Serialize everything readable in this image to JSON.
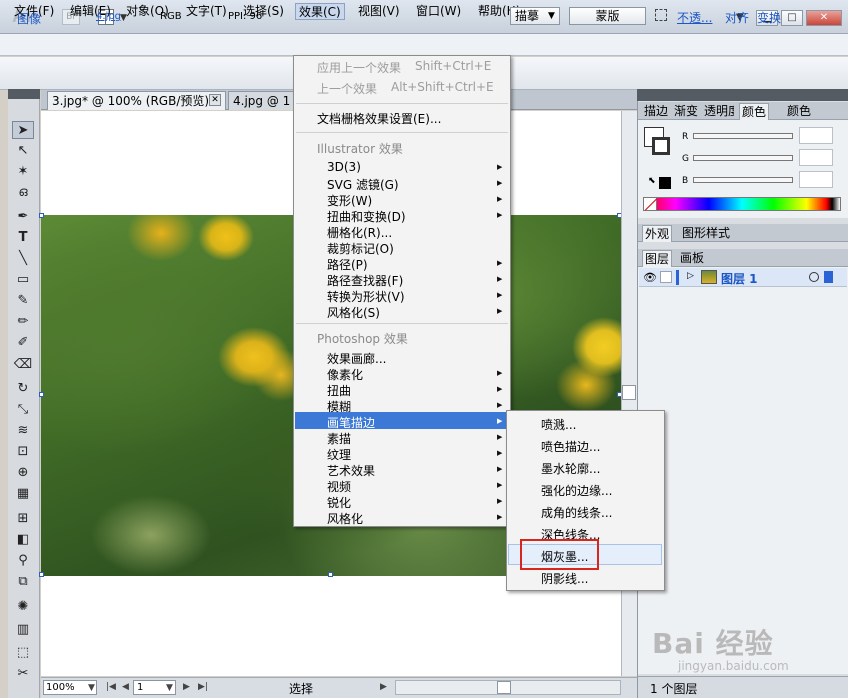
{
  "app": {
    "logo": "Ai",
    "bridge": "Br",
    "window_buttons": [
      "▁",
      "□",
      "✕"
    ]
  },
  "menubar": [
    "文件(F)",
    "编辑(E)",
    "对象(O)",
    "文字(T)",
    "选择(S)",
    "效果(C)",
    "视图(V)",
    "窗口(W)",
    "帮助(H)"
  ],
  "control_bar": {
    "image_label": "图像",
    "file": "4.jpg",
    "color_mode": "RGB",
    "ppi": "PPI: 96",
    "trace_button": "描摹",
    "mask_button": "蒙版",
    "opacity_link": "不透...",
    "align_link": "对齐",
    "transform_link": "变换"
  },
  "tabs": {
    "doc1": "3.jpg* @ 100% (RGB/预览)",
    "doc2": "4.jpg @ 1"
  },
  "status": {
    "zoom": "100%",
    "page": "1",
    "mode": "选择"
  },
  "effect_menu": {
    "apply_last": "应用上一个效果",
    "apply_last_sc": "Shift+Ctrl+E",
    "last_effect": "上一个效果",
    "last_effect_sc": "Alt+Shift+Ctrl+E",
    "raster_settings": "文档栅格效果设置(E)...",
    "illustrator_header": "Illustrator 效果",
    "illustrator_items": [
      "3D(3)",
      "SVG 滤镜(G)",
      "变形(W)",
      "扭曲和变换(D)",
      "栅格化(R)...",
      "裁剪标记(O)",
      "路径(P)",
      "路径查找器(F)",
      "转换为形状(V)",
      "风格化(S)"
    ],
    "photoshop_header": "Photoshop 效果",
    "photoshop_items": [
      "效果画廊...",
      "像素化",
      "扭曲",
      "模糊",
      "画笔描边",
      "素描",
      "纹理",
      "艺术效果",
      "视频",
      "锐化",
      "风格化"
    ]
  },
  "brush_submenu": [
    "喷溅...",
    "喷色描边...",
    "墨水轮廓...",
    "强化的边缘...",
    "成角的线条...",
    "深色线条...",
    "烟灰墨...",
    "阴影线..."
  ],
  "panels": {
    "tabs_top": [
      "描边",
      "渐变",
      "透明度",
      "颜色",
      "颜色"
    ],
    "color_channels": [
      "R",
      "G",
      "B"
    ],
    "tabs_mid": [
      "外观",
      "图形样式"
    ],
    "tabs_layers": [
      "图层",
      "画板"
    ],
    "layer_name": "图层 1",
    "layer_count": "1 个图层"
  },
  "watermark": {
    "logo": "Bai 经验",
    "url": "jingyan.baidu.com"
  },
  "colors": {
    "menu_highlight": "#3c79d6",
    "annotation_box": "#d7261f",
    "link_blue": "#1c57c4"
  }
}
